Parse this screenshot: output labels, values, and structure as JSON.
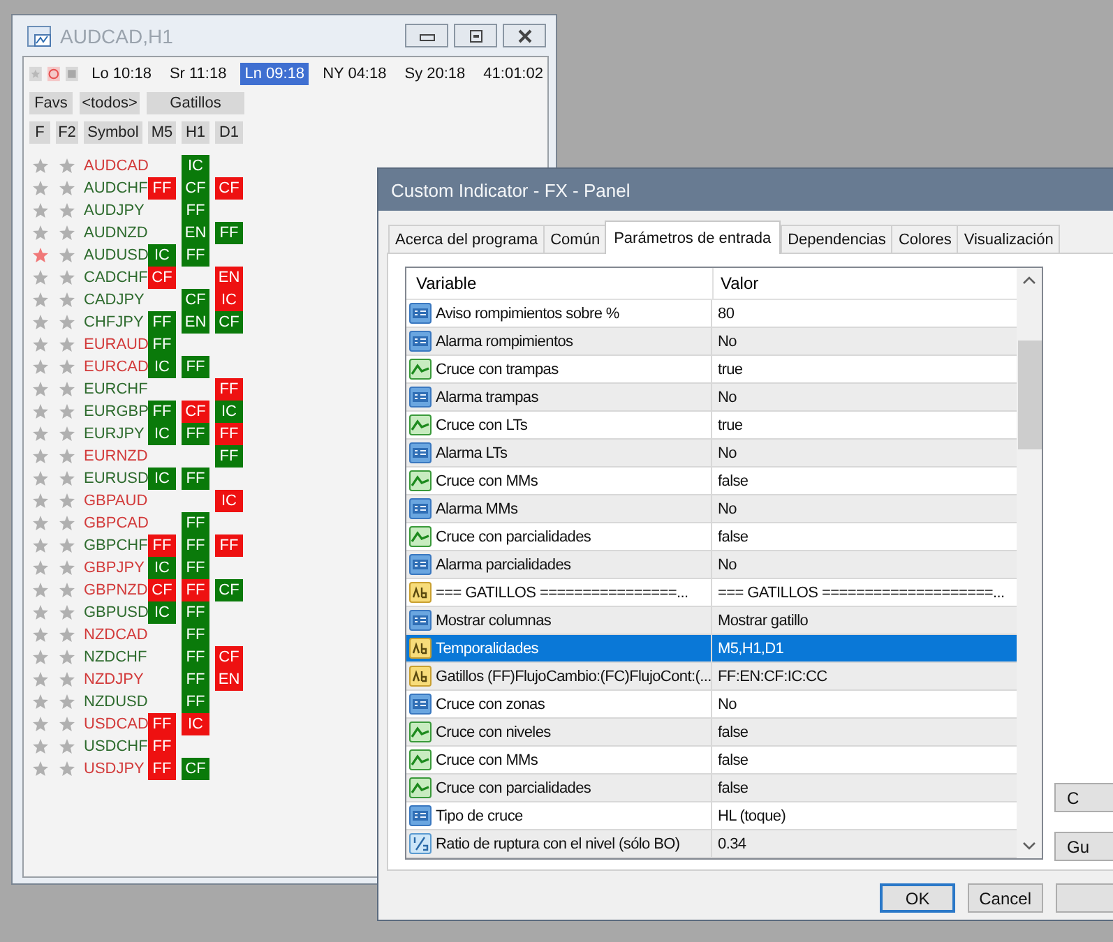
{
  "chart_window": {
    "title": "AUDCAD,H1",
    "sessions": [
      {
        "label": "Lo 10:18",
        "selected": false
      },
      {
        "label": "Sr 11:18",
        "selected": false
      },
      {
        "label": "Ln 09:18",
        "selected": true
      },
      {
        "label": "NY 04:18",
        "selected": false
      },
      {
        "label": "Sy 20:18",
        "selected": false
      }
    ],
    "countdown": "41:01:02",
    "filters": [
      "Favs",
      "<todos>",
      "Gatillos"
    ],
    "columns": [
      "F",
      "F2",
      "Symbol",
      "M5",
      "H1",
      "D1"
    ],
    "rows": [
      {
        "symbol": "AUDCAD",
        "color": "#d23a3a",
        "fav": false,
        "signals": {
          "h1": {
            "text": "IC",
            "color": "#0a7a0a"
          }
        }
      },
      {
        "symbol": "AUDCHF",
        "color": "#2e6b2e",
        "fav": false,
        "signals": {
          "m5": {
            "text": "FF",
            "color": "#ee1111"
          },
          "h1": {
            "text": "CF",
            "color": "#0a7a0a"
          },
          "d1": {
            "text": "CF",
            "color": "#ee1111"
          }
        }
      },
      {
        "symbol": "AUDJPY",
        "color": "#2e6b2e",
        "fav": false,
        "signals": {
          "h1": {
            "text": "FF",
            "color": "#0a7a0a"
          }
        }
      },
      {
        "symbol": "AUDNZD",
        "color": "#2e6b2e",
        "fav": false,
        "signals": {
          "h1": {
            "text": "EN",
            "color": "#0a7a0a"
          },
          "d1": {
            "text": "FF",
            "color": "#0a7a0a"
          }
        }
      },
      {
        "symbol": "AUDUSD",
        "color": "#2e6b2e",
        "fav": true,
        "signals": {
          "m5": {
            "text": "IC",
            "color": "#0a7a0a"
          },
          "h1": {
            "text": "FF",
            "color": "#0a7a0a"
          }
        }
      },
      {
        "symbol": "CADCHF",
        "color": "#2e6b2e",
        "fav": false,
        "signals": {
          "m5": {
            "text": "CF",
            "color": "#ee1111"
          },
          "d1": {
            "text": "EN",
            "color": "#ee1111"
          }
        }
      },
      {
        "symbol": "CADJPY",
        "color": "#2e6b2e",
        "fav": false,
        "signals": {
          "h1": {
            "text": "CF",
            "color": "#0a7a0a"
          },
          "d1": {
            "text": "IC",
            "color": "#ee1111"
          }
        }
      },
      {
        "symbol": "CHFJPY",
        "color": "#2e6b2e",
        "fav": false,
        "signals": {
          "m5": {
            "text": "FF",
            "color": "#0a7a0a"
          },
          "h1": {
            "text": "EN",
            "color": "#0a7a0a"
          },
          "d1": {
            "text": "CF",
            "color": "#0a7a0a"
          }
        }
      },
      {
        "symbol": "EURAUD",
        "color": "#d23a3a",
        "fav": false,
        "signals": {
          "m5": {
            "text": "FF",
            "color": "#0a7a0a"
          }
        }
      },
      {
        "symbol": "EURCAD",
        "color": "#d23a3a",
        "fav": false,
        "signals": {
          "m5": {
            "text": "IC",
            "color": "#0a7a0a"
          },
          "h1": {
            "text": "FF",
            "color": "#0a7a0a"
          }
        }
      },
      {
        "symbol": "EURCHF",
        "color": "#2e6b2e",
        "fav": false,
        "signals": {
          "d1": {
            "text": "FF",
            "color": "#ee1111"
          }
        }
      },
      {
        "symbol": "EURGBP",
        "color": "#2e6b2e",
        "fav": false,
        "signals": {
          "m5": {
            "text": "FF",
            "color": "#0a7a0a"
          },
          "h1": {
            "text": "CF",
            "color": "#ee1111"
          },
          "d1": {
            "text": "IC",
            "color": "#0a7a0a"
          }
        }
      },
      {
        "symbol": "EURJPY",
        "color": "#2e6b2e",
        "fav": false,
        "signals": {
          "m5": {
            "text": "IC",
            "color": "#0a7a0a"
          },
          "h1": {
            "text": "FF",
            "color": "#0a7a0a"
          },
          "d1": {
            "text": "FF",
            "color": "#ee1111"
          }
        }
      },
      {
        "symbol": "EURNZD",
        "color": "#d23a3a",
        "fav": false,
        "signals": {
          "d1": {
            "text": "FF",
            "color": "#0a7a0a"
          }
        }
      },
      {
        "symbol": "EURUSD",
        "color": "#2e6b2e",
        "fav": false,
        "signals": {
          "m5": {
            "text": "IC",
            "color": "#0a7a0a"
          },
          "h1": {
            "text": "FF",
            "color": "#0a7a0a"
          }
        }
      },
      {
        "symbol": "GBPAUD",
        "color": "#d23a3a",
        "fav": false,
        "signals": {
          "d1": {
            "text": "IC",
            "color": "#ee1111"
          }
        }
      },
      {
        "symbol": "GBPCAD",
        "color": "#d23a3a",
        "fav": false,
        "signals": {
          "h1": {
            "text": "FF",
            "color": "#0a7a0a"
          }
        }
      },
      {
        "symbol": "GBPCHF",
        "color": "#2e6b2e",
        "fav": false,
        "signals": {
          "m5": {
            "text": "FF",
            "color": "#ee1111"
          },
          "h1": {
            "text": "FF",
            "color": "#0a7a0a"
          },
          "d1": {
            "text": "FF",
            "color": "#ee1111"
          }
        }
      },
      {
        "symbol": "GBPJPY",
        "color": "#d23a3a",
        "fav": false,
        "signals": {
          "m5": {
            "text": "IC",
            "color": "#0a7a0a"
          },
          "h1": {
            "text": "FF",
            "color": "#0a7a0a"
          }
        }
      },
      {
        "symbol": "GBPNZD",
        "color": "#d23a3a",
        "fav": false,
        "signals": {
          "m5": {
            "text": "CF",
            "color": "#ee1111"
          },
          "h1": {
            "text": "FF",
            "color": "#ee1111"
          },
          "d1": {
            "text": "CF",
            "color": "#0a7a0a"
          }
        }
      },
      {
        "symbol": "GBPUSD",
        "color": "#2e6b2e",
        "fav": false,
        "signals": {
          "m5": {
            "text": "IC",
            "color": "#0a7a0a"
          },
          "h1": {
            "text": "FF",
            "color": "#0a7a0a"
          }
        }
      },
      {
        "symbol": "NZDCAD",
        "color": "#d23a3a",
        "fav": false,
        "signals": {
          "h1": {
            "text": "FF",
            "color": "#0a7a0a"
          }
        }
      },
      {
        "symbol": "NZDCHF",
        "color": "#2e6b2e",
        "fav": false,
        "signals": {
          "h1": {
            "text": "FF",
            "color": "#0a7a0a"
          },
          "d1": {
            "text": "CF",
            "color": "#ee1111"
          }
        }
      },
      {
        "symbol": "NZDJPY",
        "color": "#d23a3a",
        "fav": false,
        "signals": {
          "h1": {
            "text": "FF",
            "color": "#0a7a0a"
          },
          "d1": {
            "text": "EN",
            "color": "#ee1111"
          }
        }
      },
      {
        "symbol": "NZDUSD",
        "color": "#2e6b2e",
        "fav": false,
        "signals": {
          "h1": {
            "text": "FF",
            "color": "#0a7a0a"
          }
        }
      },
      {
        "symbol": "USDCAD",
        "color": "#d23a3a",
        "fav": false,
        "signals": {
          "m5": {
            "text": "FF",
            "color": "#ee1111"
          },
          "h1": {
            "text": "IC",
            "color": "#ee1111"
          }
        }
      },
      {
        "symbol": "USDCHF",
        "color": "#2e6b2e",
        "fav": false,
        "signals": {
          "m5": {
            "text": "FF",
            "color": "#ee1111"
          }
        }
      },
      {
        "symbol": "USDJPY",
        "color": "#d23a3a",
        "fav": false,
        "signals": {
          "m5": {
            "text": "FF",
            "color": "#ee1111"
          },
          "h1": {
            "text": "CF",
            "color": "#0a7a0a"
          }
        }
      }
    ]
  },
  "dialog": {
    "title": "Custom Indicator - FX - Panel",
    "tabs": [
      {
        "label": "Acerca del programa",
        "selected": false
      },
      {
        "label": "Común",
        "selected": false
      },
      {
        "label": "Parámetros de entrada",
        "selected": true
      },
      {
        "label": "Dependencias",
        "selected": false
      },
      {
        "label": "Colores",
        "selected": false
      },
      {
        "label": "Visualización",
        "selected": false
      }
    ],
    "table": {
      "columns": [
        "Variable",
        "Valor"
      ],
      "rows": [
        {
          "kind": "number",
          "variable": "Aviso rompimientos sobre %",
          "value": "80",
          "selected": false
        },
        {
          "kind": "number",
          "variable": "Alarma rompimientos",
          "value": "No",
          "selected": false
        },
        {
          "kind": "bool",
          "variable": "Cruce con trampas",
          "value": "true",
          "selected": false
        },
        {
          "kind": "number",
          "variable": "Alarma trampas",
          "value": "No",
          "selected": false
        },
        {
          "kind": "bool",
          "variable": "Cruce con LTs",
          "value": "true",
          "selected": false
        },
        {
          "kind": "number",
          "variable": "Alarma LTs",
          "value": "No",
          "selected": false
        },
        {
          "kind": "bool",
          "variable": "Cruce con MMs",
          "value": "false",
          "selected": false
        },
        {
          "kind": "number",
          "variable": "Alarma MMs",
          "value": "No",
          "selected": false
        },
        {
          "kind": "bool",
          "variable": "Cruce con parcialidades",
          "value": "false",
          "selected": false
        },
        {
          "kind": "number",
          "variable": "Alarma parcialidades",
          "value": "No",
          "selected": false
        },
        {
          "kind": "text",
          "variable": "=== GATILLOS ================...",
          "value": "=== GATILLOS ====================...",
          "selected": false
        },
        {
          "kind": "number",
          "variable": "Mostrar columnas",
          "value": "Mostrar gatillo",
          "selected": false
        },
        {
          "kind": "text",
          "variable": "Temporalidades",
          "value": "M5,H1,D1",
          "selected": true
        },
        {
          "kind": "text",
          "variable": "Gatillos (FF)FlujoCambio:(FC)FlujoCont:(...",
          "value": "FF:EN:CF:IC:CC",
          "selected": false
        },
        {
          "kind": "number",
          "variable": "Cruce con zonas",
          "value": "No",
          "selected": false
        },
        {
          "kind": "bool",
          "variable": "Cruce con niveles",
          "value": "false",
          "selected": false
        },
        {
          "kind": "bool",
          "variable": "Cruce con MMs",
          "value": "false",
          "selected": false
        },
        {
          "kind": "bool",
          "variable": "Cruce con parcialidades",
          "value": "false",
          "selected": false
        },
        {
          "kind": "number",
          "variable": "Tipo de cruce",
          "value": "HL (toque)",
          "selected": false
        },
        {
          "kind": "fraction",
          "variable": "Ratio de ruptura con el nivel (sólo BO)",
          "value": "0.34",
          "selected": false
        }
      ]
    },
    "side_buttons": [
      "C",
      "Gu"
    ],
    "buttons": [
      "OK",
      "Cancel"
    ]
  }
}
